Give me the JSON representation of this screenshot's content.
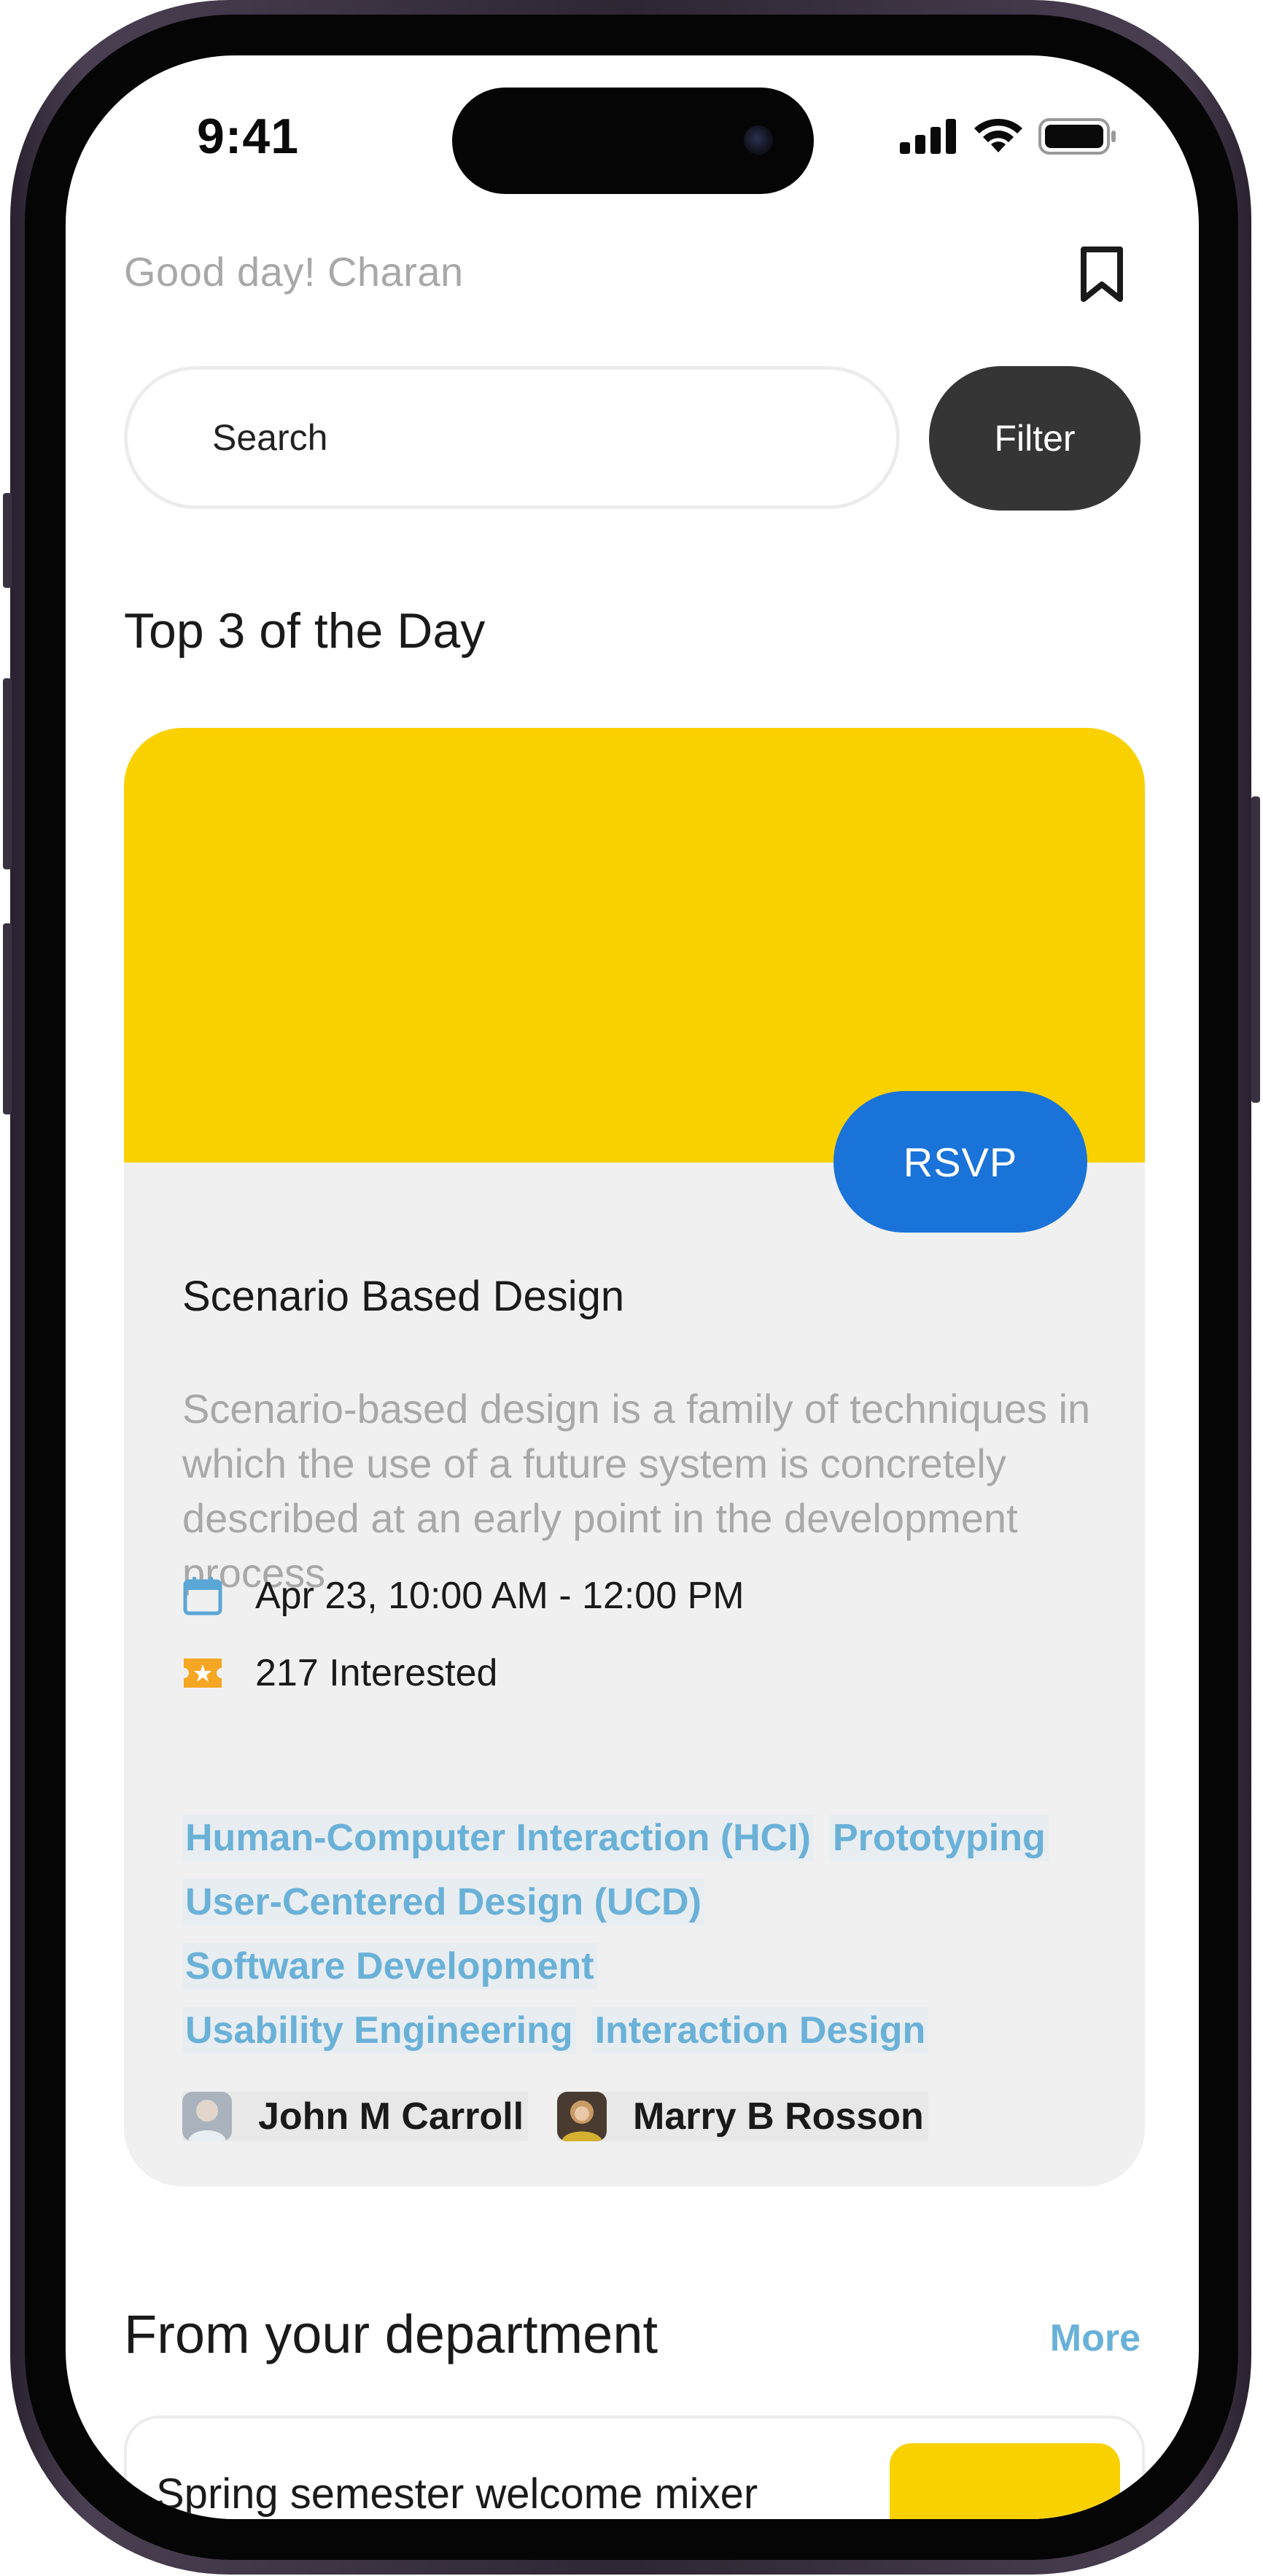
{
  "status_bar": {
    "time": "9:41"
  },
  "header": {
    "greeting": "Good day! Charan"
  },
  "search": {
    "placeholder": "Search",
    "filter_label": "Filter"
  },
  "top_section": {
    "title": "Top 3 of the Day"
  },
  "featured_event": {
    "banner_color": "#FAD100",
    "rsvp_label": "RSVP",
    "title": "Scenario Based Design",
    "description": "Scenario-based design is a family of techniques in which the use of a future system is concretely described at an early point in the development process.",
    "datetime": "Apr 23, 10:00 AM - 12:00 PM",
    "interested": "217 Interested",
    "tag_lines": [
      [
        "Human-Computer Interaction (HCI)",
        "Prototyping"
      ],
      [
        "User-Centered Design (UCD)"
      ],
      [
        "Software Development"
      ],
      [
        "Usability Engineering",
        "Interaction Design"
      ]
    ],
    "presenters": [
      {
        "name": "John M Carroll"
      },
      {
        "name": "Marry B Rosson"
      }
    ]
  },
  "department_section": {
    "title": "From your department",
    "more_label": "More",
    "cards": [
      {
        "title": "Spring semester welcome mixer"
      }
    ]
  },
  "colors": {
    "accent_blue": "#1A73D8",
    "tag_blue": "#6AB1D8",
    "banner_yellow": "#FAD100",
    "filter_dark": "#353535"
  },
  "icons": {
    "bookmark": "bookmark-icon",
    "calendar": "calendar-icon",
    "ticket": "ticket-star-icon",
    "signal": "cellular-signal-icon",
    "wifi": "wifi-icon",
    "battery": "battery-icon"
  }
}
